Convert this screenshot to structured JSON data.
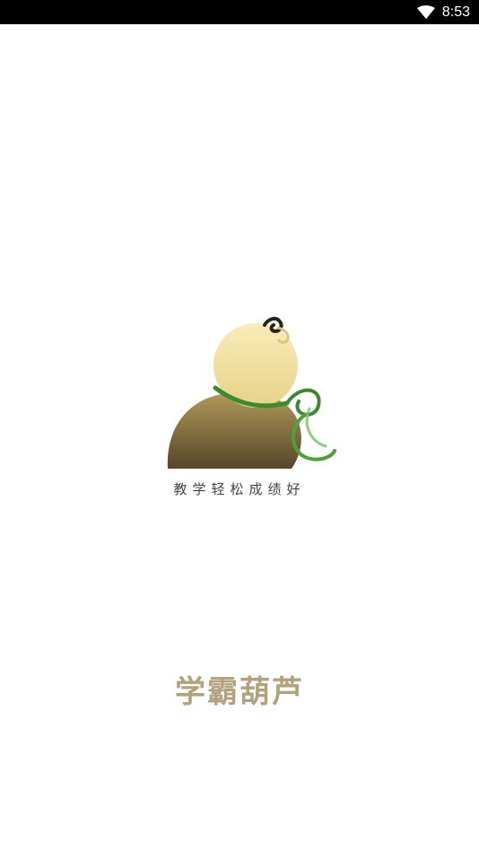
{
  "status_bar": {
    "time": "8:53",
    "icons": [
      "wifi-icon"
    ]
  },
  "splash": {
    "logo": "gourd-logo",
    "slogan": "教学轻松成绩好",
    "brand_name": "学霸葫芦",
    "colors": {
      "brand_text": "#b2a27b",
      "gourd_top": "#f3e3a3",
      "gourd_bottom": "#5c4c2a",
      "vine": "#3f8f2f"
    }
  }
}
